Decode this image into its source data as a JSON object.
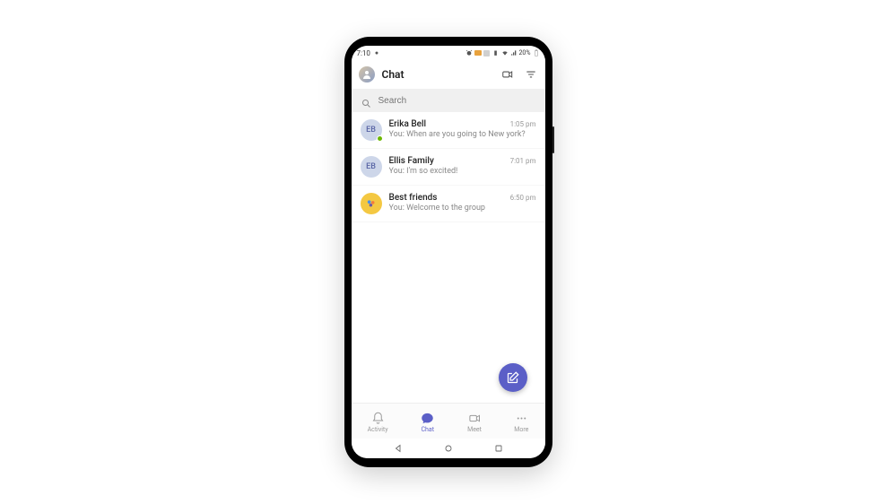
{
  "status": {
    "time": "7:10",
    "battery_pct": "20%"
  },
  "header": {
    "title": "Chat"
  },
  "search": {
    "placeholder": "Search"
  },
  "chats": [
    {
      "name": "Erika Bell",
      "initials": "EB",
      "preview": "You: When are you going to New york?",
      "time": "1:05 pm",
      "presence": "available"
    },
    {
      "name": "Ellis Family",
      "initials": "EB",
      "preview": "You: I'm so excited!",
      "time": "7:01 pm"
    },
    {
      "name": "Best friends",
      "preview": "You: Welcome to the group",
      "time": "6:50 pm"
    }
  ],
  "nav": {
    "items": [
      {
        "label": "Activity"
      },
      {
        "label": "Chat"
      },
      {
        "label": "Meet"
      },
      {
        "label": "More"
      }
    ],
    "active_index": 1
  },
  "colors": {
    "accent": "#5b5fc7"
  }
}
